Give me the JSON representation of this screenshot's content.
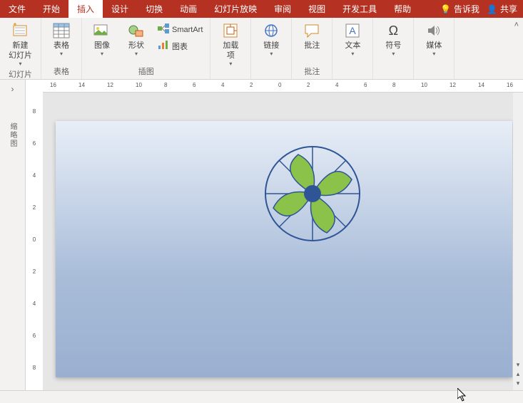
{
  "tabs": {
    "file": "文件",
    "home": "开始",
    "insert": "插入",
    "design": "设计",
    "transition": "切换",
    "animation": "动画",
    "slideshow": "幻灯片放映",
    "review": "审阅",
    "view": "视图",
    "developer": "开发工具",
    "help": "帮助",
    "tellme": "告诉我",
    "share": "共享"
  },
  "ribbon": {
    "newslide": "新建\n幻灯片",
    "slides_group": "幻灯片",
    "table": "表格",
    "tables_group": "表格",
    "images": "图像",
    "shapes": "形状",
    "smartart": "SmartArt",
    "chart": "图表",
    "illus_group": "插图",
    "addins": "加载\n项",
    "links": "链接",
    "comments": "批注",
    "comments_group": "批注",
    "text": "文本",
    "symbols": "符号",
    "media": "媒体"
  },
  "outline": {
    "label": "缩略图"
  },
  "ruler_h": [
    "16",
    "14",
    "12",
    "10",
    "8",
    "6",
    "4",
    "2",
    "0",
    "2",
    "4",
    "6",
    "8",
    "10",
    "12",
    "14",
    "16"
  ],
  "ruler_v": [
    "8",
    "6",
    "4",
    "2",
    "0",
    "2",
    "4",
    "6",
    "8"
  ]
}
